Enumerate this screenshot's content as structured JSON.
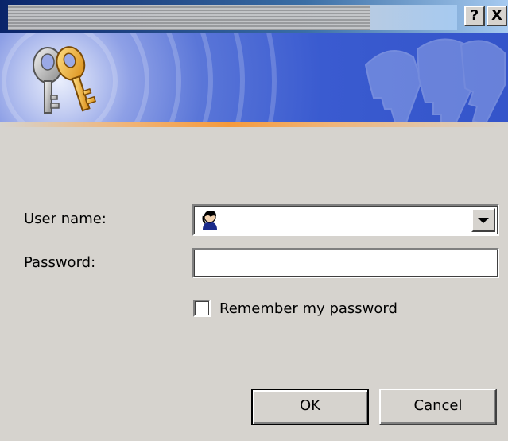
{
  "titlebar": {
    "help_label": "?",
    "close_label": "X"
  },
  "banner": {
    "icon": "keys-icon",
    "watermark": "keys-watermark"
  },
  "form": {
    "username_label": "User name:",
    "username_value": "",
    "username_icon": "user-icon",
    "password_label": "Password:",
    "password_value": "",
    "remember_label": "Remember my password",
    "remember_checked": false
  },
  "buttons": {
    "ok_label": "OK",
    "cancel_label": "Cancel"
  },
  "colors": {
    "dialog_bg": "#d6d3ce",
    "banner_blue": "#3a5bd0",
    "accent_orange": "#f59a3c"
  }
}
